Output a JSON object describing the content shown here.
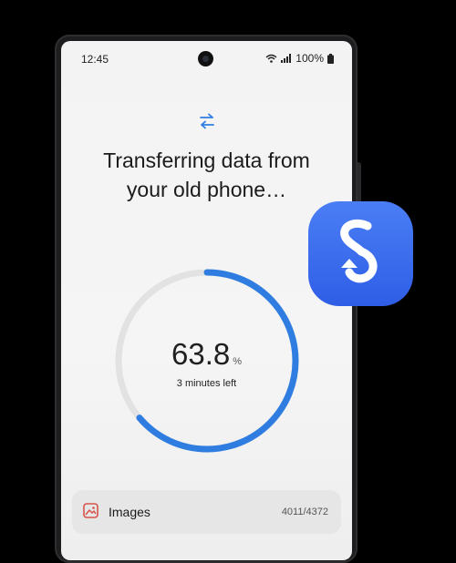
{
  "status_bar": {
    "time": "12:45",
    "battery": "100%",
    "icons": [
      "wifi-icon",
      "signal-icon",
      "battery-icon"
    ]
  },
  "transfer": {
    "icon": "transfer-arrows-icon",
    "title_line1": "Transferring data from",
    "title_line2": "your old phone…",
    "progress": 63.8,
    "percent_text": "63.8",
    "percent_unit": "%",
    "time_left": "3 minutes left"
  },
  "list": {
    "items": [
      {
        "icon": "image-icon",
        "label": "Images",
        "count": "4011/4372"
      }
    ]
  },
  "app_badge": {
    "icon": "smart-switch-app-icon"
  },
  "colors": {
    "accent_blue": "#2f7de1",
    "progress_track": "#e2e2e2",
    "app_icon_bg": "#3a6df0",
    "image_icon_red": "#d8524b"
  }
}
